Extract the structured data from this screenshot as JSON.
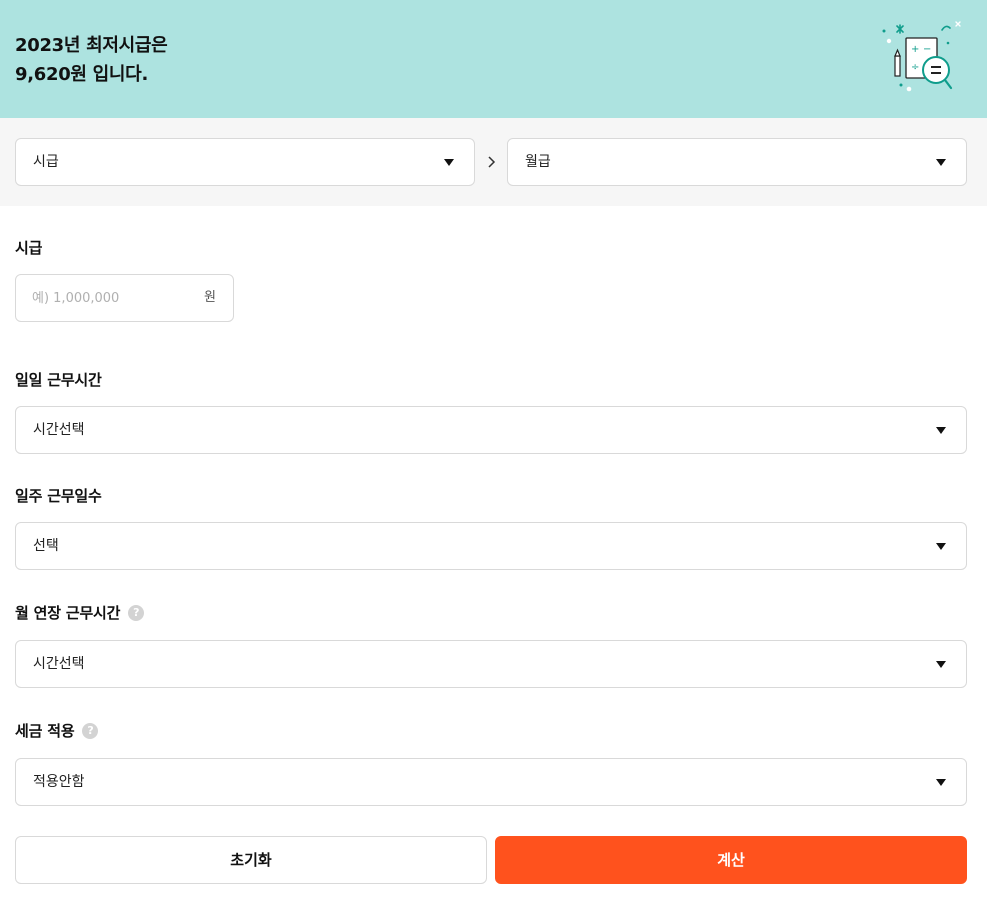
{
  "banner": {
    "title_line1": "2023년 최저시급은",
    "title_line2": "9,620원 입니다."
  },
  "converter": {
    "from_value": "시급",
    "to_value": "월급"
  },
  "wage": {
    "label": "시급",
    "placeholder": "예) 1,000,000",
    "unit": "원"
  },
  "daily_hours": {
    "label": "일일 근무시간",
    "value": "시간선택"
  },
  "weekly_days": {
    "label": "일주 근무일수",
    "value": "선택"
  },
  "overtime": {
    "label": "월 연장 근무시간",
    "value": "시간선택"
  },
  "tax": {
    "label": "세금 적용",
    "value": "적용안함"
  },
  "help_glyph": "?",
  "buttons": {
    "reset": "초기화",
    "calculate": "계산"
  },
  "colors": {
    "banner_bg": "#ade3e0",
    "accent": "#ff521d",
    "illustration": "#0f9d8c"
  }
}
